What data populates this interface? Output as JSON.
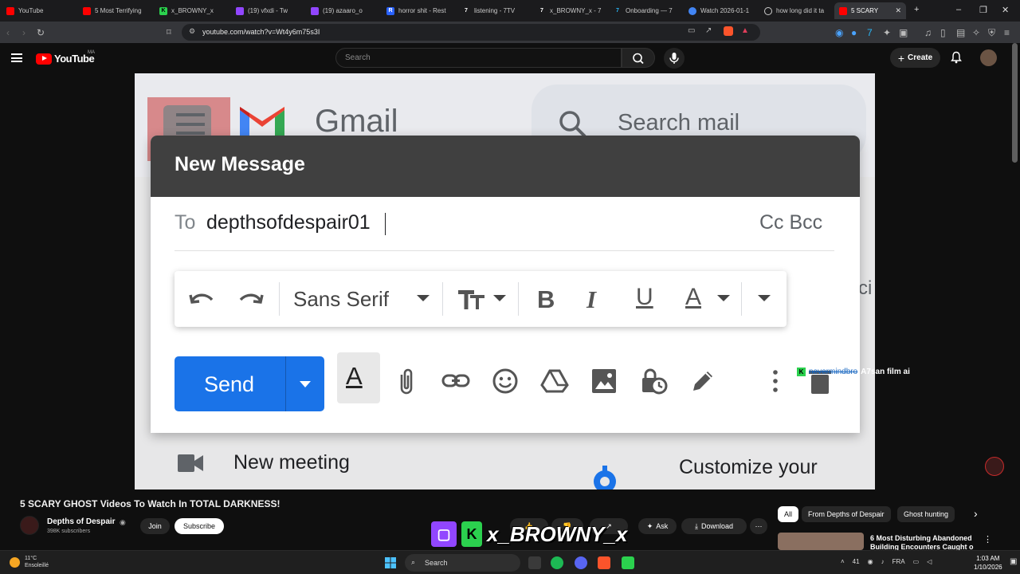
{
  "browser": {
    "tabs": [
      {
        "label": "YouTube",
        "color": "#ff0000"
      },
      {
        "label": "5 Most Terrifying",
        "color": "#ff0000"
      },
      {
        "label": "x_BROWNY_x",
        "color": "#2bd14e"
      },
      {
        "label": "(19) vfxdi - Tw",
        "color": "#9146ff"
      },
      {
        "label": "(19) azaaro_o",
        "color": "#9146ff"
      },
      {
        "label": "horror shit - Rest",
        "color": "#2962ff"
      },
      {
        "label": "listening - 7TV",
        "color": "#ffffff"
      },
      {
        "label": "x_BROWNY_x - 7",
        "color": "#ffffff"
      },
      {
        "label": "Onboarding — 7",
        "color": "#29b6f6"
      },
      {
        "label": "Watch 2026-01-1",
        "color": "#4285f4"
      },
      {
        "label": "how long did it ta",
        "color": "#ffffff"
      },
      {
        "label": "5 SCARY",
        "color": "#ff0000",
        "active": true
      }
    ],
    "url": "youtube.com/watch?v=Wt4y6m75s3I"
  },
  "youtube": {
    "logo_text": "YouTube",
    "region": "MA",
    "search_placeholder": "Search",
    "create_label": "Create"
  },
  "video": {
    "gmail_word": "Gmail",
    "search_mail": "Search mail",
    "bg_text_right": "ci",
    "new_meeting": "New meeting",
    "customize": "Customize your",
    "compose": {
      "title": "New Message",
      "to_label": "To",
      "to_value": "depthsofdespair01",
      "cc_bcc": "Cc Bcc",
      "font_name": "Sans Serif",
      "send_label": "Send"
    }
  },
  "overlay": {
    "streamer_name": "x_BROWNY_x",
    "chat_user": "nevermindbro",
    "chat_message": "A7san film ai"
  },
  "watch": {
    "title": "5 SCARY GHOST Videos To Watch In TOTAL DARKNESS!",
    "channel": "Depths of Despair",
    "subscribers": "398K subscribers",
    "join_label": "Join",
    "subscribe_label": "Subscribe",
    "ask_label": "Ask",
    "download_label": "Download",
    "chips": [
      "All",
      "From Depths of Despair",
      "Ghost hunting"
    ],
    "recommended_title": "6 Most Disturbing Abandoned Building Encounters Caught o"
  },
  "taskbar": {
    "temperature": "11°C",
    "weather": "Ensoleillé",
    "search_label": "Search",
    "tray_count": "41",
    "lang": "FRA",
    "time": "1:03 AM",
    "date": "1/10/2026"
  },
  "colors": {
    "send_blue": "#1a73e8",
    "compose_header": "#404040",
    "yt_red": "#ff0000"
  }
}
